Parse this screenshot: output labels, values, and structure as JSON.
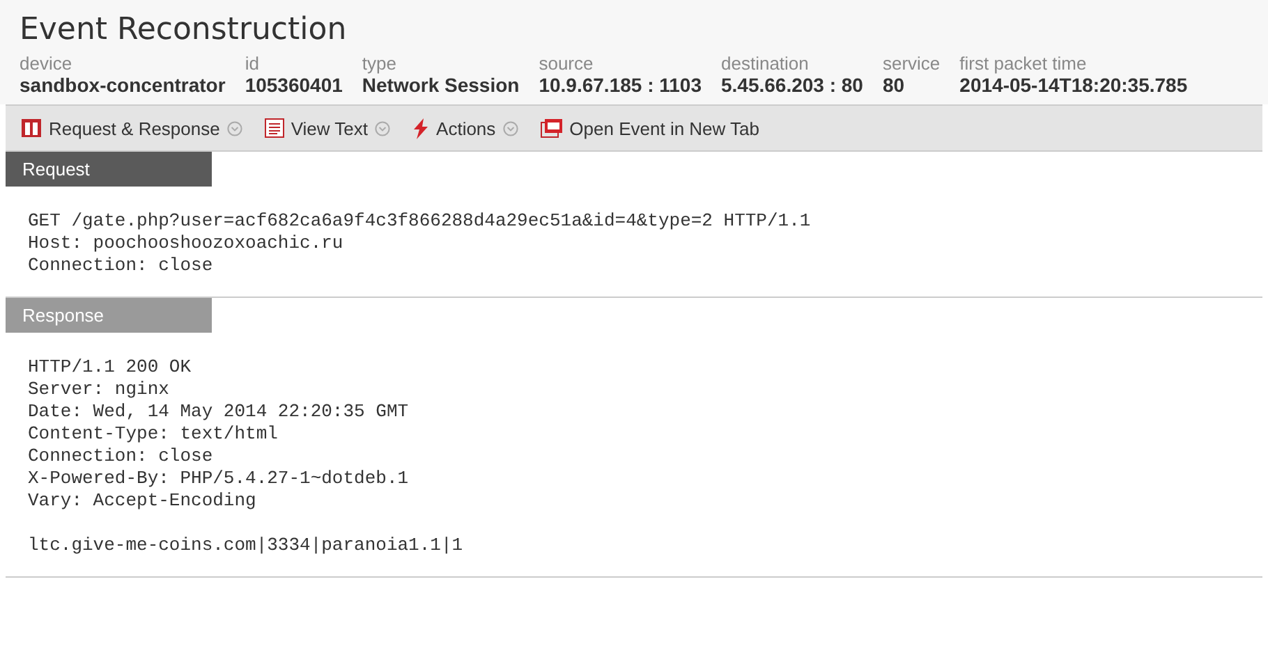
{
  "title": "Event Reconstruction",
  "meta": [
    {
      "label": "device",
      "value": "sandbox-concentrator"
    },
    {
      "label": "id",
      "value": "105360401"
    },
    {
      "label": "type",
      "value": "Network Session"
    },
    {
      "label": "source",
      "value": "10.9.67.185 : 1103"
    },
    {
      "label": "destination",
      "value": "5.45.66.203 : 80"
    },
    {
      "label": "service",
      "value": "80"
    },
    {
      "label": "first packet time",
      "value": "2014-05-14T18:20:35.785"
    }
  ],
  "toolbar": [
    {
      "label": "Request & Response",
      "kind": "columns",
      "has_menu": true
    },
    {
      "label": "View Text",
      "kind": "text",
      "has_menu": true
    },
    {
      "label": "Actions",
      "kind": "bolt",
      "has_menu": true
    },
    {
      "label": "Open Event in New Tab",
      "kind": "window",
      "has_menu": false
    }
  ],
  "sections": [
    {
      "title": "Request",
      "selected": true,
      "paragraphs": [
        [
          "GET /gate.php?user=acf682ca6a9f4c3f866288d4a29ec51a&id=4&type=2 HTTP/1.1",
          "Host: poochooshoozoxoachic.ru",
          "Connection: close"
        ]
      ]
    },
    {
      "title": "Response",
      "selected": false,
      "paragraphs": [
        [
          "HTTP/1.1 200 OK",
          "Server: nginx",
          "Date: Wed, 14 May 2014 22:20:35 GMT",
          "Content-Type: text/html",
          "Connection: close",
          "X-Powered-By: PHP/5.4.27-1~dotdeb.1",
          "Vary: Accept-Encoding"
        ],
        [
          "ltc.give-me-coins.com|3334|paranoia1.1|1"
        ]
      ]
    }
  ]
}
